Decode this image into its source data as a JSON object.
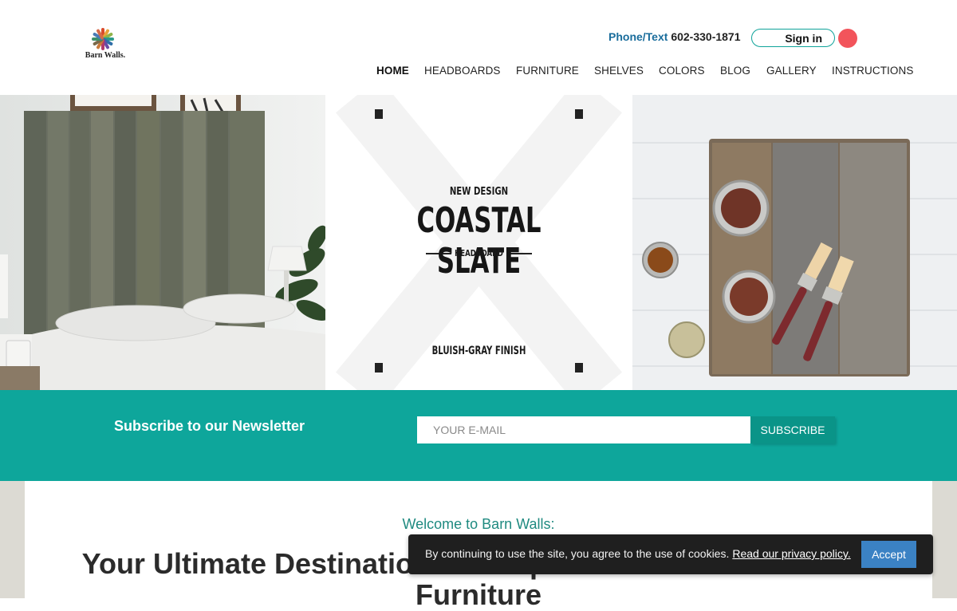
{
  "brand": {
    "name": "Barn Walls."
  },
  "header": {
    "phone_label": "Phone/Text",
    "phone_number": "602-330-1871",
    "signin_label": "Sign in"
  },
  "nav": {
    "items": [
      {
        "label": "HOME",
        "active": true
      },
      {
        "label": "HEADBOARDS"
      },
      {
        "label": "FURNITURE"
      },
      {
        "label": "SHELVES"
      },
      {
        "label": "COLORS"
      },
      {
        "label": "BLOG"
      },
      {
        "label": "GALLERY"
      },
      {
        "label": "INSTRUCTIONS"
      }
    ]
  },
  "hero": {
    "badge_top": "NEW DESIGN",
    "title": "COASTAL SLATE",
    "subtitle": "HEADBOARD",
    "finish": "BLUISH-GRAY FINISH"
  },
  "newsletter": {
    "title": "Subscribe to our Newsletter",
    "email_placeholder": "YOUR E-MAIL",
    "button_label": "SUBSCRIBE"
  },
  "content": {
    "welcome": "Welcome to Barn Walls:",
    "headline": "Your Ultimate Destination for Exquisite Handcrafted Wood Furniture"
  },
  "cookie": {
    "text": "By continuing to use the site, you agree to the use of cookies.",
    "link_label": "Read our privacy policy.",
    "accept_label": "Accept"
  },
  "colors": {
    "teal": "#0ea69b",
    "teal_dark": "#0a9488",
    "phone_blue": "#1a6d9c",
    "welcome_teal": "#1f8a80",
    "accept_blue": "#3b82c4",
    "red_dot": "#f2545b"
  }
}
